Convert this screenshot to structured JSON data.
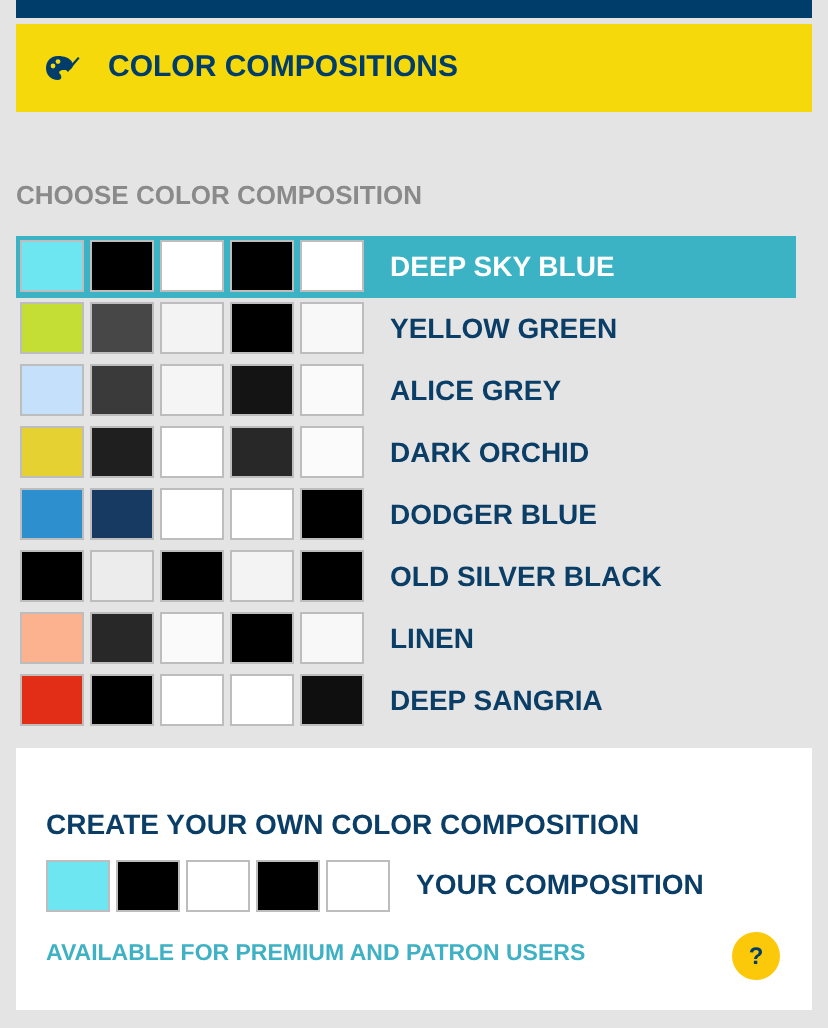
{
  "header": {
    "title": "COLOR COMPOSITIONS"
  },
  "chooser": {
    "heading": "CHOOSE COLOR COMPOSITION",
    "compositions": [
      {
        "name": "DEEP SKY BLUE",
        "selected": true,
        "swatches": [
          {
            "color": "#6ee6f2"
          },
          {
            "color": "#000000"
          },
          {
            "color": "#ffffff"
          },
          {
            "color": "#000000"
          },
          {
            "color": "#ffffff"
          }
        ]
      },
      {
        "name": "YELLOW GREEN",
        "selected": false,
        "swatches": [
          {
            "color": "#c5de35"
          },
          {
            "color": "#474747"
          },
          {
            "color": "#f3f3f3"
          },
          {
            "color": "#000000"
          },
          {
            "color": "#f8f8f8"
          }
        ]
      },
      {
        "name": "ALICE GREY",
        "selected": false,
        "swatches": [
          {
            "color": "#c4e0fa"
          },
          {
            "color": "#3a3a3a"
          },
          {
            "color": "#f5f5f5"
          },
          {
            "color": "#141414"
          },
          {
            "color": "#fafafa"
          }
        ]
      },
      {
        "name": "DARK ORCHID",
        "selected": false,
        "swatches": [
          {
            "color": "#e6d132"
          },
          {
            "color": "#1f1f1f"
          },
          {
            "color": "#ffffff"
          },
          {
            "color": "#282828"
          },
          {
            "color": "#fbfbfb"
          }
        ]
      },
      {
        "name": "DODGER BLUE",
        "selected": false,
        "swatches": [
          {
            "color": "#2e8fcf"
          },
          {
            "color": "#173a62"
          },
          {
            "color": "#ffffff"
          },
          {
            "color": "#ffffff"
          },
          {
            "color": "#000000"
          }
        ]
      },
      {
        "name": "OLD SILVER BLACK",
        "selected": false,
        "swatches": [
          {
            "color": "#000000"
          },
          {
            "color": "#ececec"
          },
          {
            "color": "#000000"
          },
          {
            "color": "#f3f3f3"
          },
          {
            "color": "#000000"
          }
        ]
      },
      {
        "name": "LINEN",
        "selected": false,
        "swatches": [
          {
            "color": "#fdb28f"
          },
          {
            "color": "#282828"
          },
          {
            "color": "#fafafa"
          },
          {
            "color": "#000000"
          },
          {
            "color": "#f8f8f8"
          }
        ]
      },
      {
        "name": "DEEP SANGRIA",
        "selected": false,
        "swatches": [
          {
            "color": "#e32e17"
          },
          {
            "color": "#000000"
          },
          {
            "color": "#ffffff"
          },
          {
            "color": "#ffffff"
          },
          {
            "color": "#0f0f0f"
          }
        ]
      }
    ]
  },
  "custom": {
    "heading": "CREATE YOUR OWN COLOR COMPOSITION",
    "label": "YOUR COMPOSITION",
    "note": "AVAILABLE FOR PREMIUM AND PATRON USERS",
    "help": "?",
    "swatches": [
      {
        "color": "#6ee6f2"
      },
      {
        "color": "#000000"
      },
      {
        "color": "#ffffff"
      },
      {
        "color": "#000000"
      },
      {
        "color": "#ffffff"
      }
    ]
  }
}
